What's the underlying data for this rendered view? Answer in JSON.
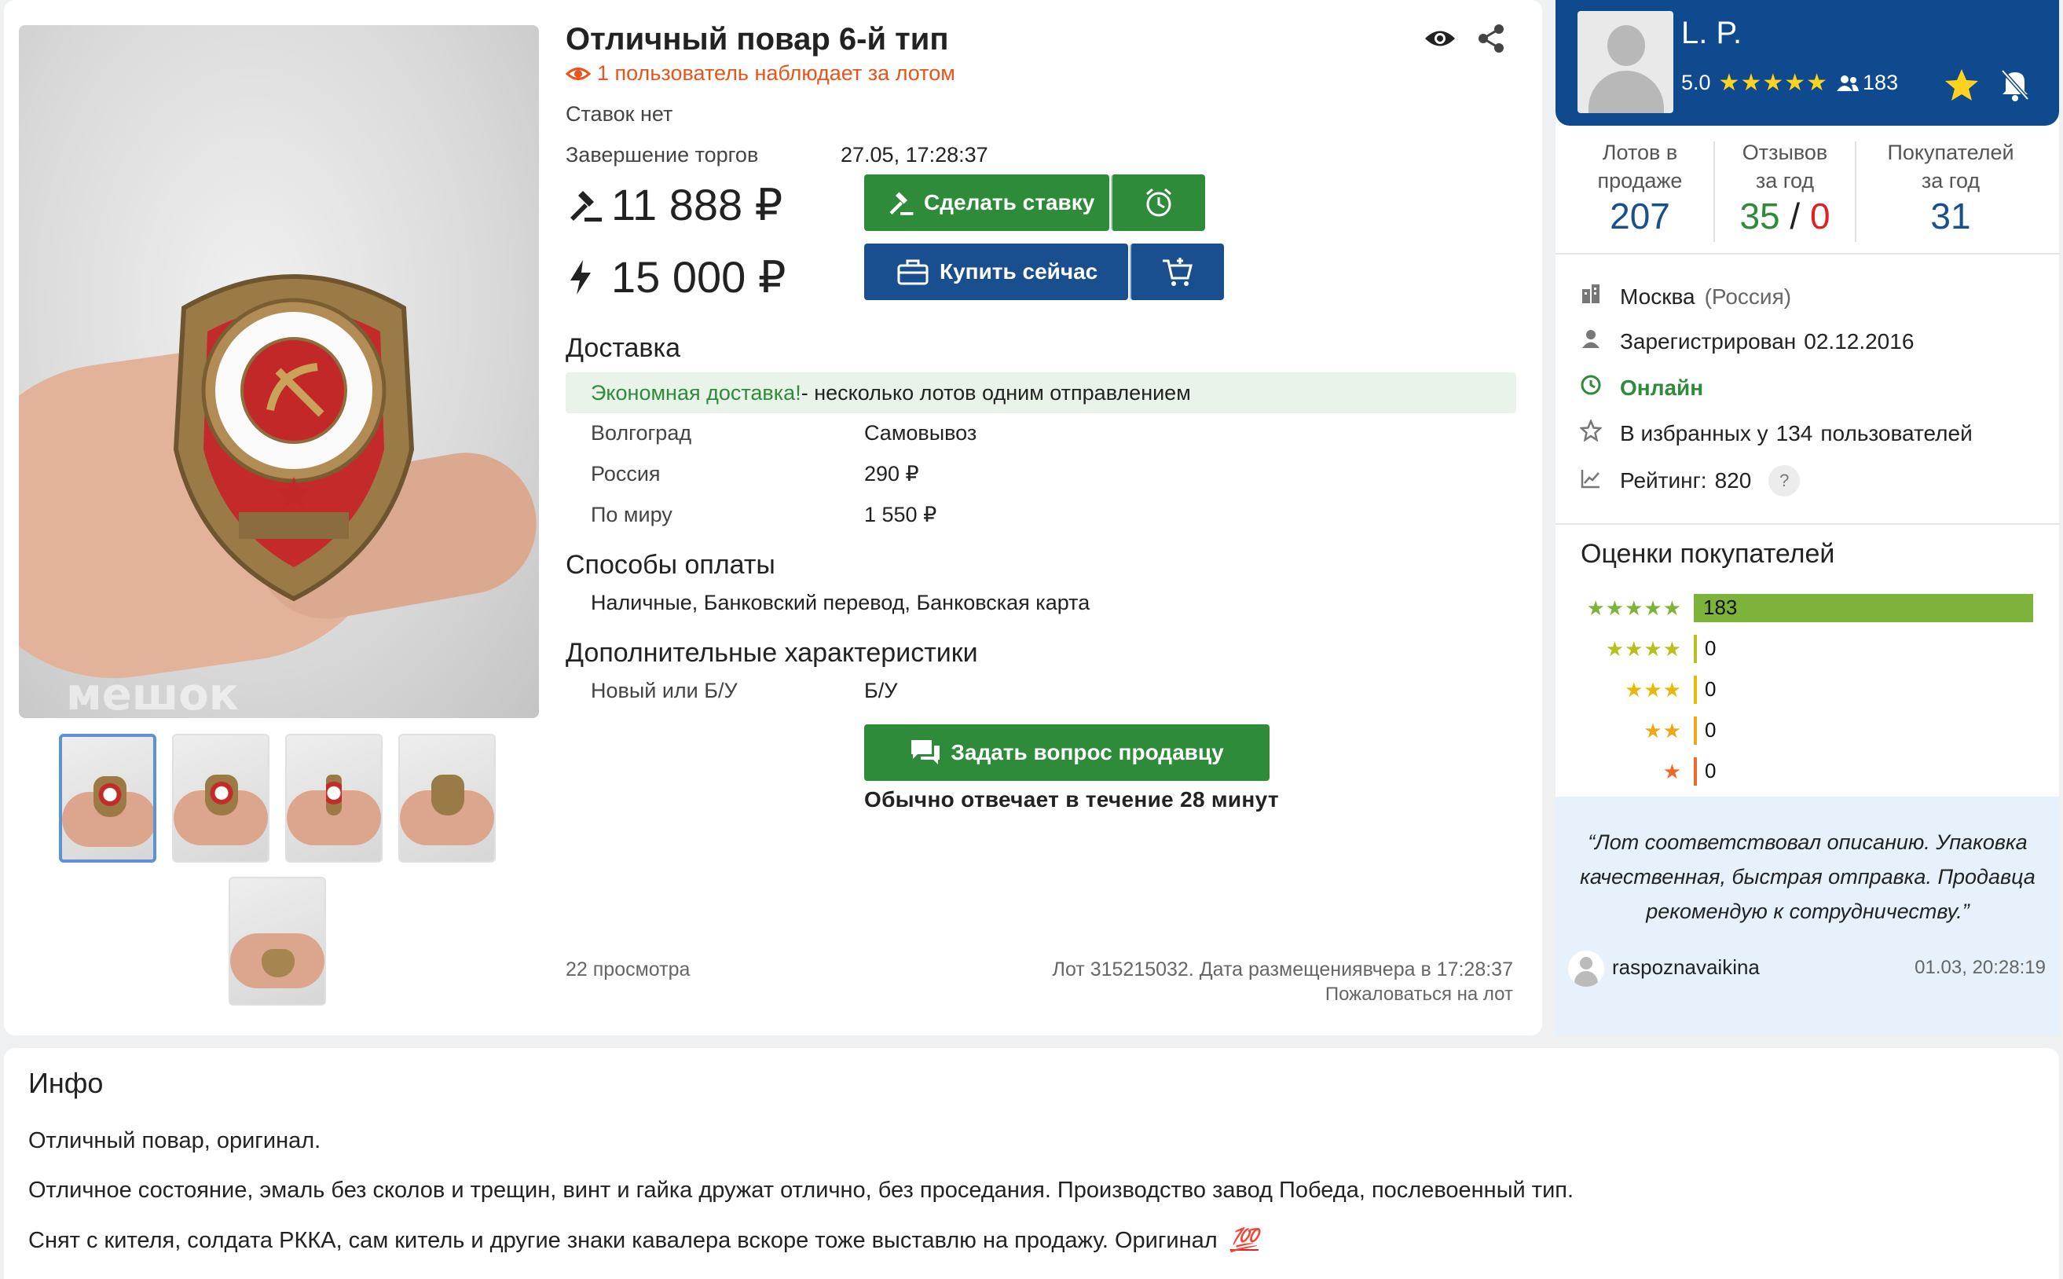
{
  "lot": {
    "title": "Отличный повар 6-й тип",
    "watchers_text": "1 пользователь наблюдает за лотом",
    "bids_status": "Ставок нет",
    "end_label": "Завершение торгов",
    "end_value": "27.05, 17:28:37",
    "current_price": "11 888 ₽",
    "buy_now_price": "15 000 ₽",
    "bid_button": "Сделать ставку",
    "buy_button": "Купить сейчас",
    "views": "22 просмотра",
    "lot_info": "Лот 315215032. Дата размещения",
    "placed_value": "вчера в 17:28:37",
    "report_link": "Пожаловаться на лот",
    "watermark": "мешок"
  },
  "delivery": {
    "title": "Доставка",
    "economy_highlight": "Экономная доставка!",
    "economy_rest": " - несколько лотов одним отправлением",
    "rows": [
      {
        "region": "Волгоград",
        "price": "Самовывоз"
      },
      {
        "region": "Россия",
        "price": "290 ₽"
      },
      {
        "region": "По миру",
        "price": "1 550 ₽"
      }
    ]
  },
  "payment": {
    "title": "Способы оплаты",
    "methods": "Наличные, Банковский перевод, Банковская карта"
  },
  "extra": {
    "title": "Дополнительные характеристики",
    "key": "Новый или Б/У",
    "value": "Б/У"
  },
  "ask": {
    "button": "Задать вопрос продавцу",
    "response_time": "Обычно отвечает в течение 28 минут"
  },
  "seller": {
    "name": "L. P.",
    "rating": "5.0",
    "stars": "★★★★★",
    "reviews_count": "183",
    "stats": [
      {
        "label1": "Лотов в",
        "label2": "продаже",
        "value": "207"
      },
      {
        "label1": "Отзывов",
        "label2": "за год",
        "value_pos": "35",
        "sep": "/",
        "value_neg": "0"
      },
      {
        "label1": "Покупателей",
        "label2": "за год",
        "value": "31"
      }
    ],
    "city": "Москва",
    "country": "(Россия)",
    "registered_label": "Зарегистрирован",
    "registered_date": "02.12.2016",
    "online": "Онлайн",
    "favorites_prefix": "В избранных у",
    "favorites_count": "134",
    "favorites_suffix": "пользователей",
    "rating_label": "Рейтинг:",
    "rating_value": "820",
    "help": "?"
  },
  "buyer_ratings": {
    "title": "Оценки покупателей",
    "rows": [
      {
        "stars": "★★★★★",
        "count": "183",
        "fraction": 1.0,
        "color": "#7db33a"
      },
      {
        "stars": "★★★★",
        "count": "0",
        "fraction": 0,
        "color": "#b5c21b"
      },
      {
        "stars": "★★★",
        "count": "0",
        "fraction": 0,
        "color": "#e8b909"
      },
      {
        "stars": "★★",
        "count": "0",
        "fraction": 0,
        "color": "#f1a614"
      },
      {
        "stars": "★",
        "count": "0",
        "fraction": 0,
        "color": "#ee6a2a"
      }
    ]
  },
  "review": {
    "text": "“Лот соответствовал описанию. Упаковка качественная, быстрая отправка. Продавца рекомендую к сотрудничеству.”",
    "author": "raspoznavaikina",
    "date": "01.03, 20:28:19"
  },
  "info": {
    "title": "Инфо",
    "p1": "Отличный повар, оригинал.",
    "p2": "Отличное состояние, эмаль без сколов и трещин, винт и гайка дружат отлично, без проседания. Производство завод Победа, послевоенный тип.",
    "p3": "Снят с кителя, солдата РККА, сам китель и другие знаки кавалера вскоре тоже выставлю на продажу. Оригинал",
    "p3_emoji": "💯"
  },
  "colors": {
    "brand_blue": "#0f4a8f",
    "action_green": "#2e8b3a",
    "watch_red": "#e8551c",
    "online_green": "#2e8b3a",
    "positive_green": "#2e8b3a",
    "negative_red": "#e02020"
  }
}
